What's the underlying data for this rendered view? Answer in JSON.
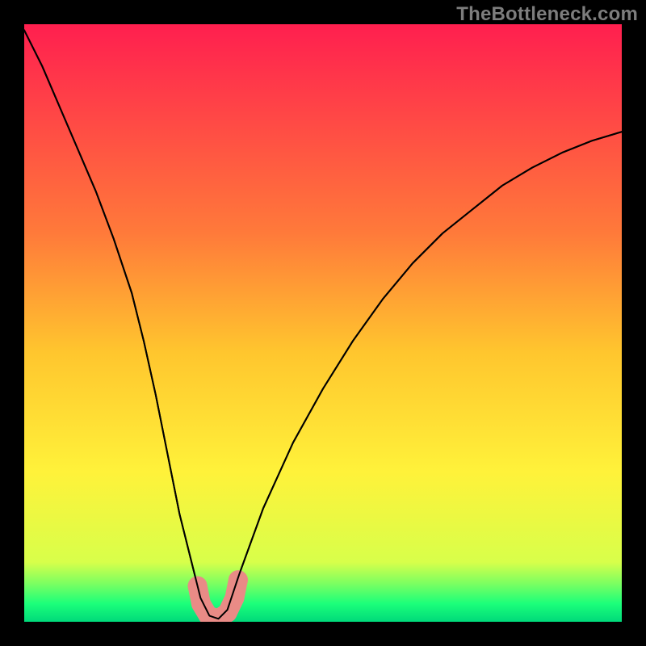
{
  "watermark": {
    "text": "TheBottleneck.com"
  },
  "chart_data": {
    "type": "line",
    "title": "",
    "xlabel": "",
    "ylabel": "",
    "xlim": [
      0,
      100
    ],
    "ylim": [
      0,
      100
    ],
    "legend": false,
    "grid": false,
    "background_gradient": {
      "stops": [
        {
          "offset": 0.0,
          "color": "#ff1f4f"
        },
        {
          "offset": 0.35,
          "color": "#ff7a3a"
        },
        {
          "offset": 0.55,
          "color": "#ffc62e"
        },
        {
          "offset": 0.75,
          "color": "#fff23a"
        },
        {
          "offset": 0.9,
          "color": "#d8ff4a"
        },
        {
          "offset": 0.935,
          "color": "#7eff60"
        },
        {
          "offset": 0.97,
          "color": "#1bff7a"
        },
        {
          "offset": 1.0,
          "color": "#00d97a"
        }
      ]
    },
    "series": [
      {
        "name": "bottleneck-curve",
        "x": [
          0,
          3,
          6,
          9,
          12,
          15,
          18,
          20,
          22,
          24,
          26,
          28,
          29.5,
          31,
          32.5,
          34,
          36,
          40,
          45,
          50,
          55,
          60,
          65,
          70,
          75,
          80,
          85,
          90,
          95,
          100
        ],
        "values": [
          99,
          93,
          86,
          79,
          72,
          64,
          55,
          47,
          38,
          28,
          18,
          10,
          4,
          1,
          0.5,
          2,
          8,
          19,
          30,
          39,
          47,
          54,
          60,
          65,
          69,
          73,
          76,
          78.5,
          80.5,
          82
        ]
      }
    ],
    "markers": {
      "name": "optimal-range",
      "color": "#e98b86",
      "points": [
        {
          "x": 29.0,
          "y": 6.0
        },
        {
          "x": 29.6,
          "y": 3.0
        },
        {
          "x": 30.8,
          "y": 1.0
        },
        {
          "x": 32.5,
          "y": 0.5
        },
        {
          "x": 34.0,
          "y": 1.5
        },
        {
          "x": 35.2,
          "y": 4.0
        },
        {
          "x": 35.8,
          "y": 7.0
        }
      ]
    }
  }
}
